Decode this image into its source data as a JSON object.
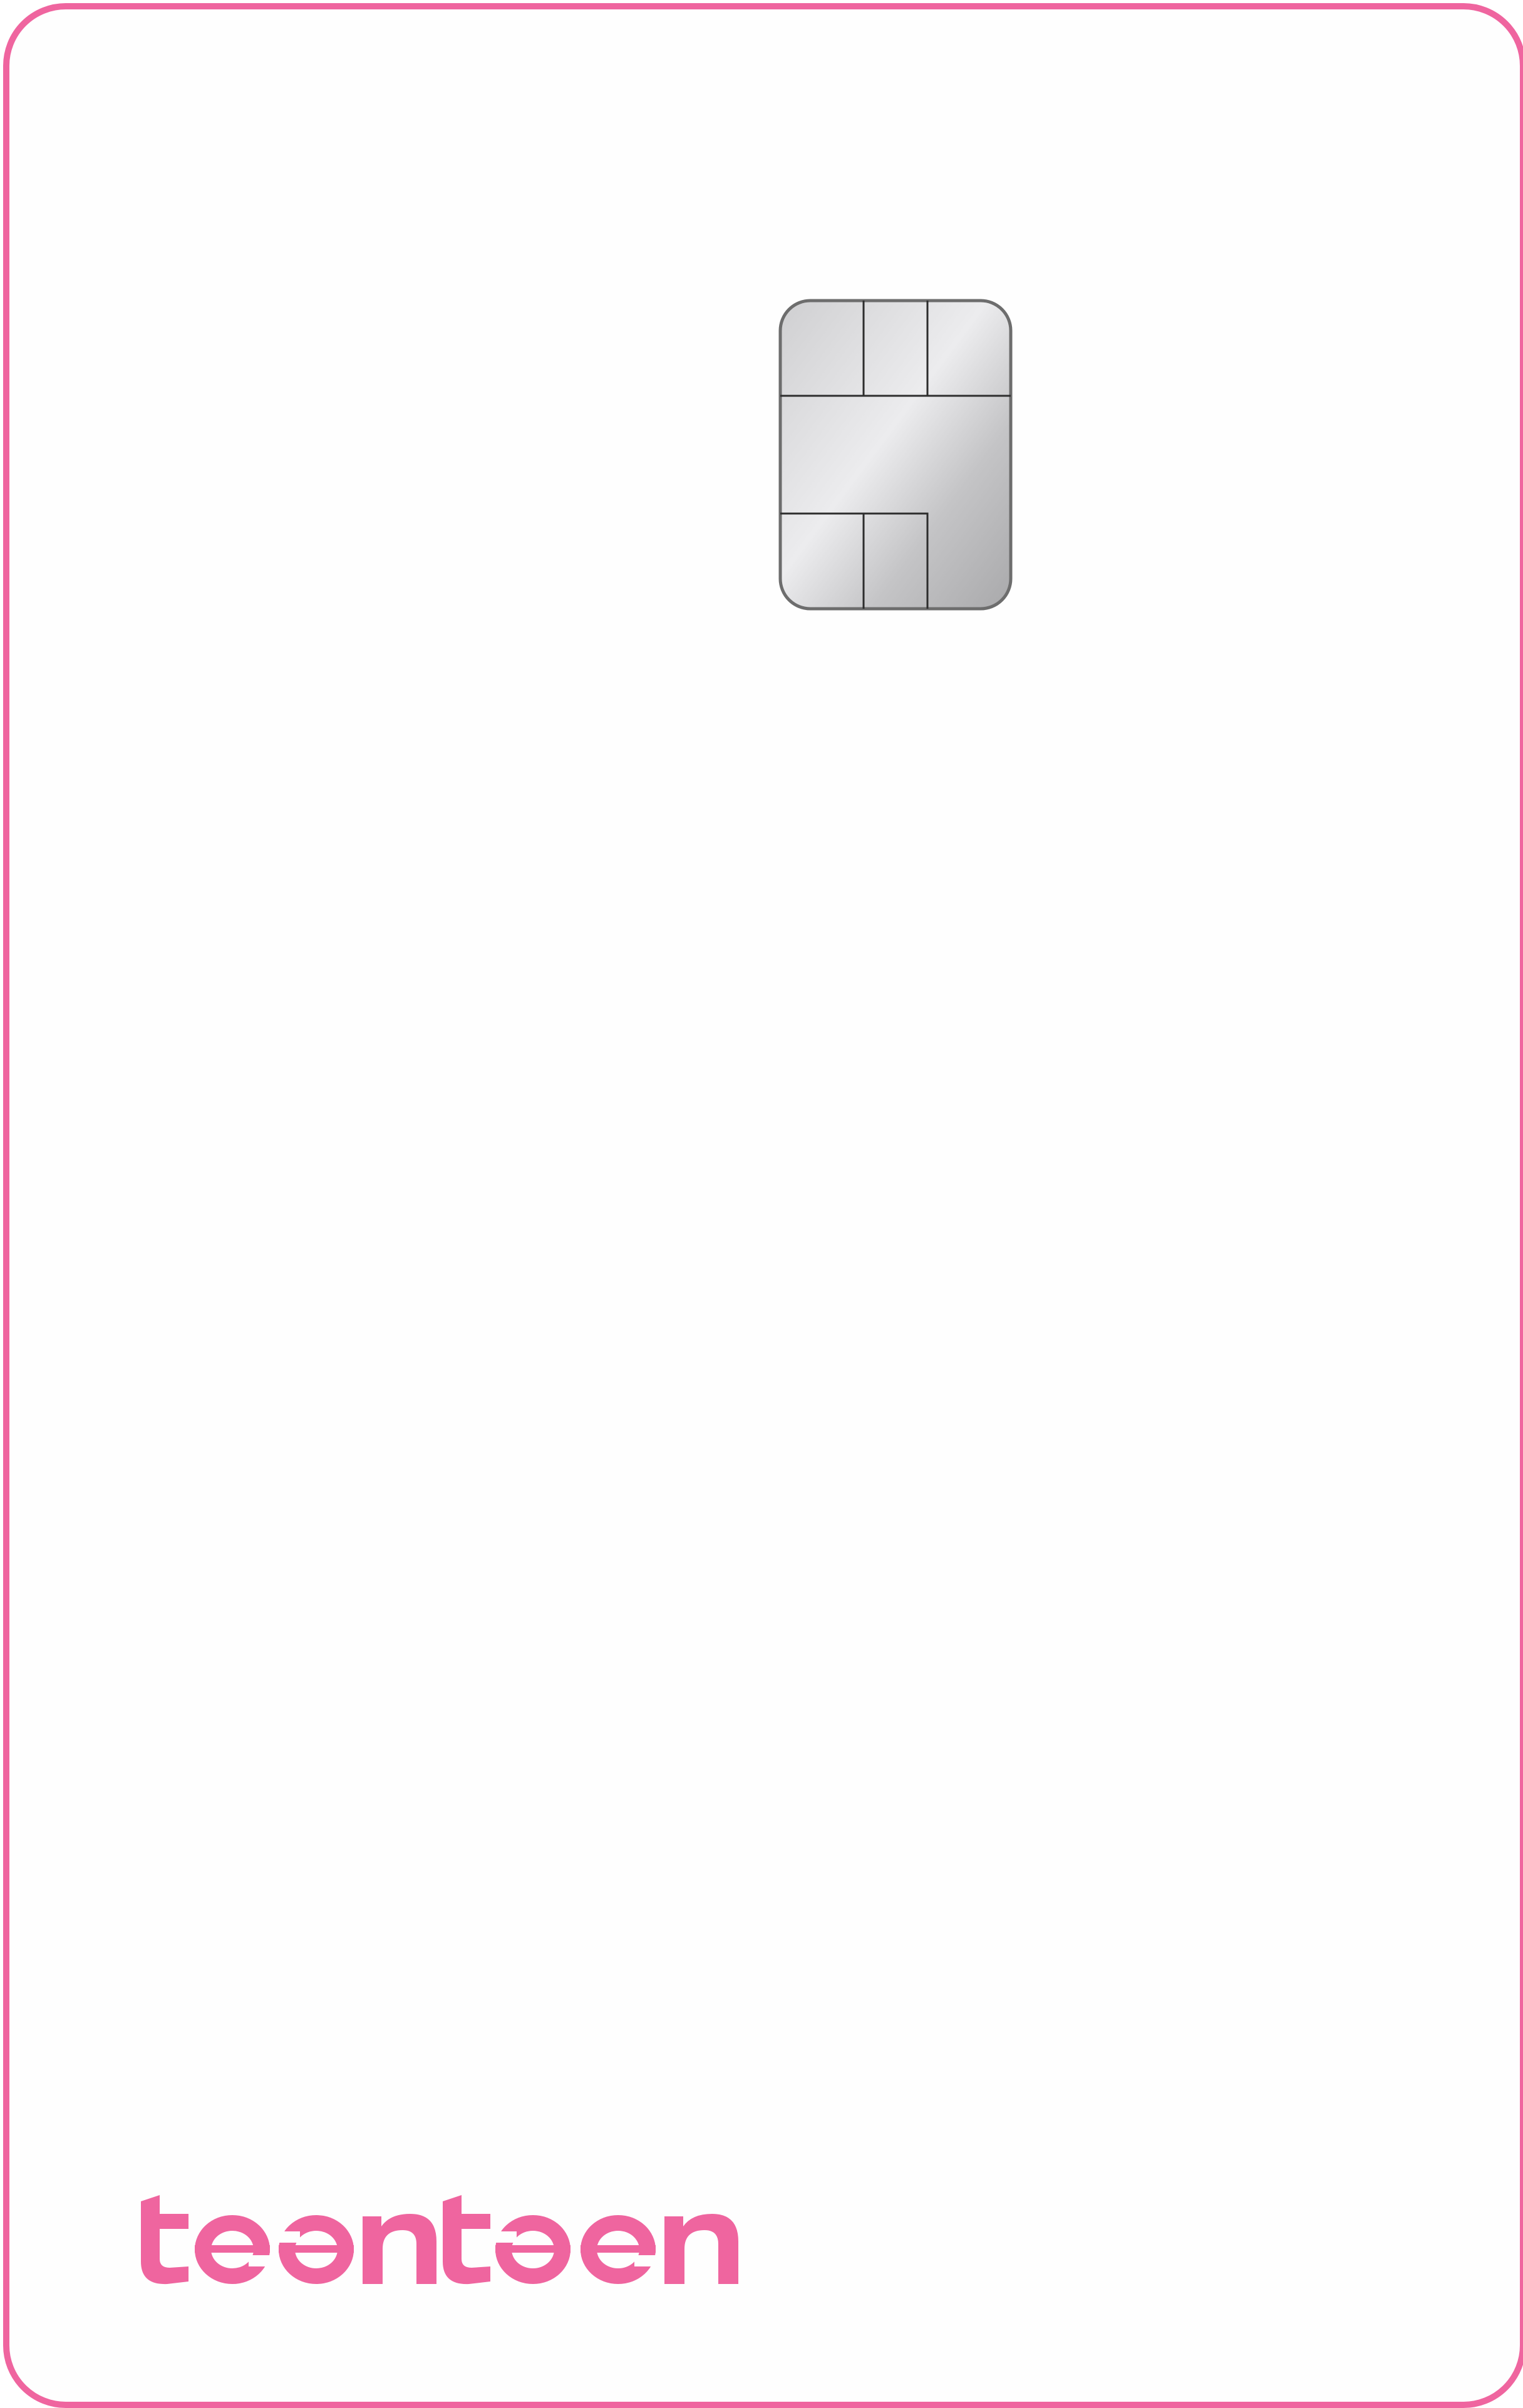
{
  "card": {
    "brand_name": "teenteen",
    "accent_color": "#EF659F",
    "chip_icon": "emv-chip-icon"
  }
}
